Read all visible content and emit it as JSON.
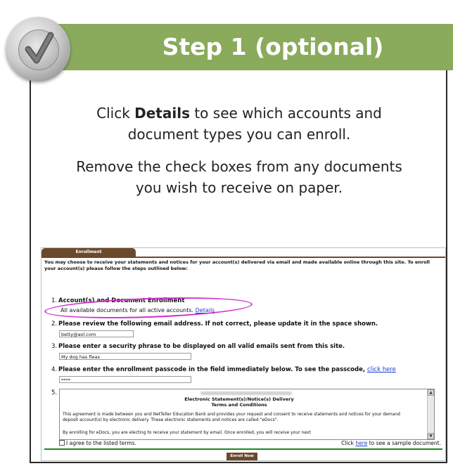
{
  "banner": {
    "title": "Step 1 (optional)"
  },
  "instructions": {
    "line1_pre": "Click ",
    "line1_bold": "Details",
    "line1_post": " to see which accounts and",
    "line2": "document types you can enroll.",
    "line3": "Remove the check boxes from any documents",
    "line4": "you wish to receive on paper."
  },
  "screenshot": {
    "tab_label": "Enrollment",
    "intro": "You may choose to receive your statements and notices for your account(s) delivered via email and made available online through this site. To enroll your account(s) please follow the steps outlined below:",
    "steps": [
      {
        "num": "1.",
        "title": "Account(s) and Document Enrollment",
        "sub": "All available documents for all active accounts. ",
        "link": "Details"
      },
      {
        "num": "2.",
        "title": "Please review the following email address. If not correct, please update it in the space shown.",
        "field": "betty@aol.com"
      },
      {
        "num": "3.",
        "title": "Please enter a security phrase to be displayed on all valid emails sent from this site.",
        "field": "My dog has fleas"
      },
      {
        "num": "4.",
        "title": "Please enter the enrollment passcode in the field immediately below. To see the passcode, ",
        "link": "click here",
        "field": "****"
      },
      {
        "num": "5."
      }
    ],
    "terms": {
      "heading1": "Electronic Statement(s)/Notice(s) Delivery",
      "heading2": "Terms and Conditions",
      "para1": "This agreement is made between you and NetTeller Education Bank and provides your request and consent to receive statements and notices for your demand deposit account(s) by electronic delivery. These electronic statements and notices are called \"eDocs\".",
      "para2": "By enrolling for eDocs, you are electing to receive your statement by email. Once enrolled, you will receive your next"
    },
    "agree_label": "I agree to the listed terms.",
    "sample_pre": "Click ",
    "sample_link": "here",
    "sample_post": " to see a sample document.",
    "enroll_button": "Enroll Now"
  },
  "colors": {
    "banner": "#8aaa5c",
    "tab": "#6b4a2b",
    "highlight_oval": "#d032cf",
    "divider": "#1b8a24",
    "link": "#1b3ec9"
  },
  "icons": {
    "badge": "checkmark-icon"
  }
}
